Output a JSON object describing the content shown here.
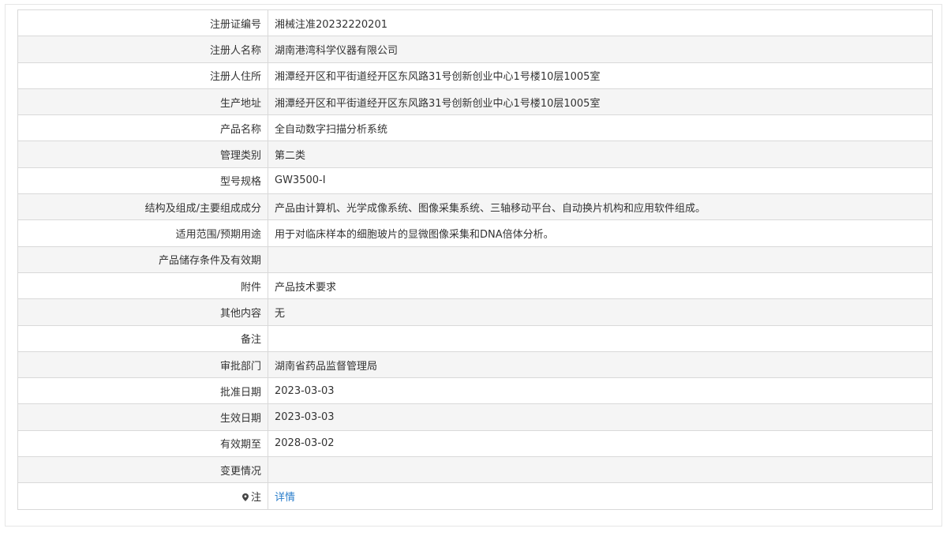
{
  "rows": [
    {
      "label": "注册证编号",
      "value": "湘械注准20232220201"
    },
    {
      "label": "注册人名称",
      "value": "湖南港湾科学仪器有限公司"
    },
    {
      "label": "注册人住所",
      "value": "湘潭经开区和平街道经开区东风路31号创新创业中心1号楼10层1005室"
    },
    {
      "label": "生产地址",
      "value": "湘潭经开区和平街道经开区东风路31号创新创业中心1号楼10层1005室"
    },
    {
      "label": "产品名称",
      "value": "全自动数字扫描分析系统"
    },
    {
      "label": "管理类别",
      "value": "第二类"
    },
    {
      "label": "型号规格",
      "value": "GW3500-I"
    },
    {
      "label": "结构及组成/主要组成成分",
      "value": "产品由计算机、光学成像系统、图像采集系统、三轴移动平台、自动换片机构和应用软件组成。"
    },
    {
      "label": "适用范围/预期用途",
      "value": "用于对临床样本的细胞玻片的显微图像采集和DNA倍体分析。"
    },
    {
      "label": "产品储存条件及有效期",
      "value": ""
    },
    {
      "label": "附件",
      "value": "产品技术要求"
    },
    {
      "label": "其他内容",
      "value": "无"
    },
    {
      "label": "备注",
      "value": ""
    },
    {
      "label": "审批部门",
      "value": "湖南省药品监督管理局"
    },
    {
      "label": "批准日期",
      "value": "2023-03-03"
    },
    {
      "label": "生效日期",
      "value": "2023-03-03"
    },
    {
      "label": "有效期至",
      "value": "2028-03-02"
    },
    {
      "label": "变更情况",
      "value": ""
    }
  ],
  "note": {
    "icon": "map-pin-icon",
    "label": "注",
    "link_text": "详情",
    "link_color": "#2a7ecb"
  }
}
